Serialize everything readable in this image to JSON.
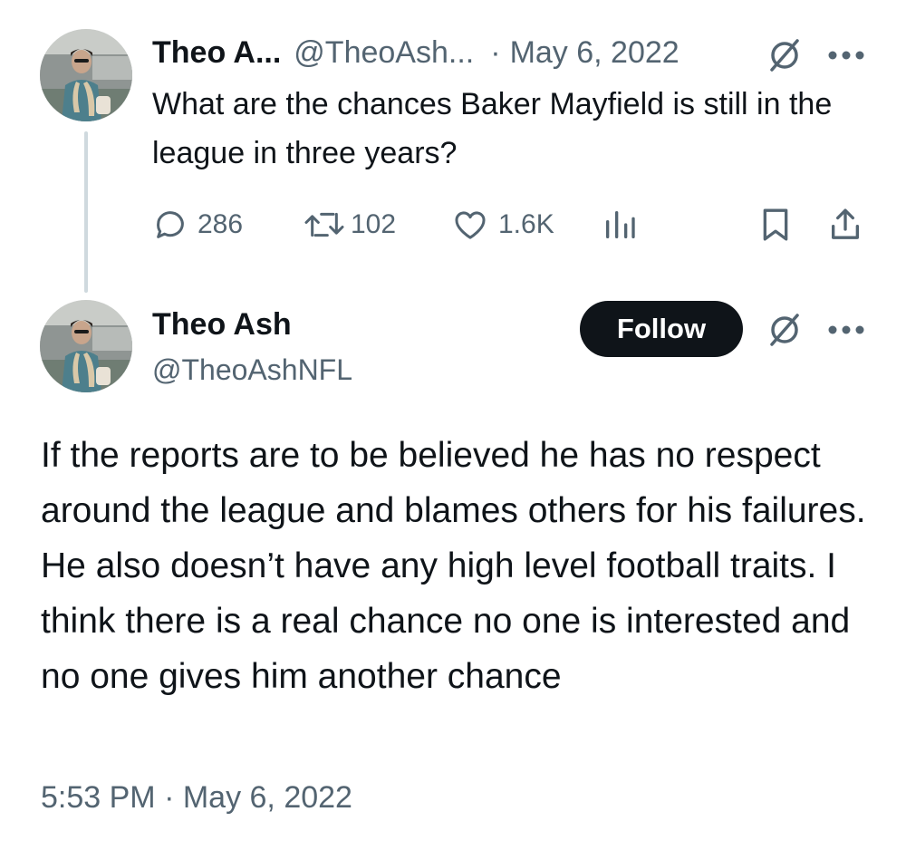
{
  "parent_tweet": {
    "author_name": "Theo A...",
    "author_handle": "@TheoAsh...",
    "separator": "·",
    "date": "May 6, 2022",
    "text": "What are the chances Baker Mayfield is still in the league in three years?",
    "replies": "286",
    "reposts": "102",
    "likes": "1.6K",
    "icons": {
      "reply": "reply-icon",
      "repost": "repost-icon",
      "like": "heart-icon",
      "views": "views-icon",
      "bookmark": "bookmark-icon",
      "share": "share-icon",
      "grok": "grok-icon",
      "more": "more-icon"
    }
  },
  "reply_tweet": {
    "author_name": "Theo Ash",
    "author_handle": "@TheoAshNFL",
    "follow_label": "Follow",
    "text": "If the reports are to be believed he has no respect around the league and blames others for his failures. He also doesn’t have any high level football traits. I think there is a real chance no one is interested and no one gives him another chance",
    "timestamp": "5:53 PM · May 6, 2022"
  },
  "colors": {
    "text_primary": "#0f1419",
    "text_secondary": "#536471",
    "thread_line": "#cfd9de",
    "follow_button_bg": "#0f1419",
    "follow_button_text": "#ffffff"
  }
}
